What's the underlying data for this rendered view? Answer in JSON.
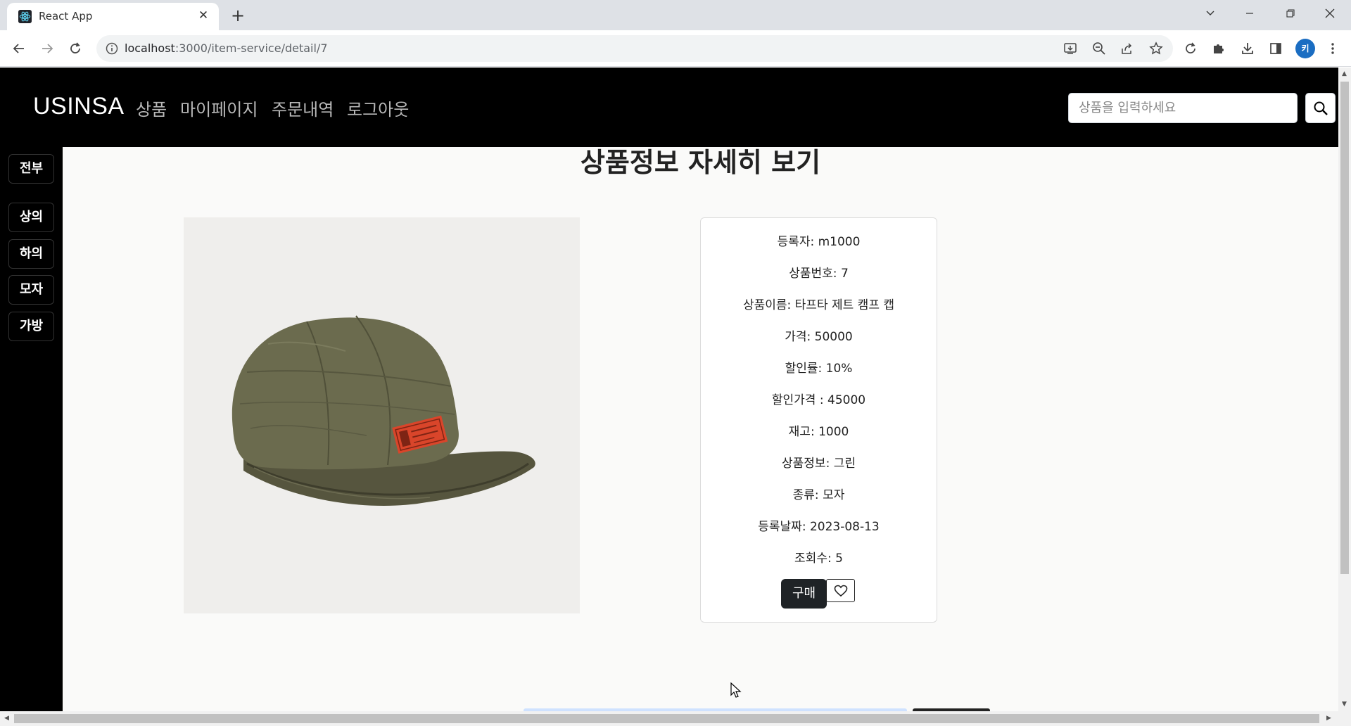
{
  "browser": {
    "tab_title": "React App",
    "url_host": "localhost",
    "url_path": ":3000/item-service/detail/7",
    "profile_initial": "키"
  },
  "navbar": {
    "brand": "USINSA",
    "links": [
      "상품",
      "마이페이지",
      "주문내역",
      "로그아웃"
    ],
    "search_placeholder": "상품을 입력하세요"
  },
  "sidebar": {
    "items": [
      "전부",
      "상의",
      "하의",
      "모자",
      "가방"
    ]
  },
  "main": {
    "title": "상품정보 자세히 보기",
    "product_image_alt": "cap-product-photo",
    "details": [
      {
        "label": "등록자",
        "value": "m1000"
      },
      {
        "label": "상품번호",
        "value": "7"
      },
      {
        "label": "상품이름",
        "value": "타프타 제트 캠프 캡"
      },
      {
        "label": "가격",
        "value": "50000"
      },
      {
        "label": "할인률",
        "value": "10%"
      },
      {
        "label": "할인가격 ",
        "value": "45000"
      },
      {
        "label": "재고",
        "value": "1000"
      },
      {
        "label": "상품정보",
        "value": "그린"
      },
      {
        "label": "종류",
        "value": "모자"
      },
      {
        "label": "등록날짜",
        "value": "2023-08-13"
      },
      {
        "label": "조회수",
        "value": "5"
      }
    ],
    "buy_label": "구매",
    "like_icon": "heart-outline-icon"
  }
}
